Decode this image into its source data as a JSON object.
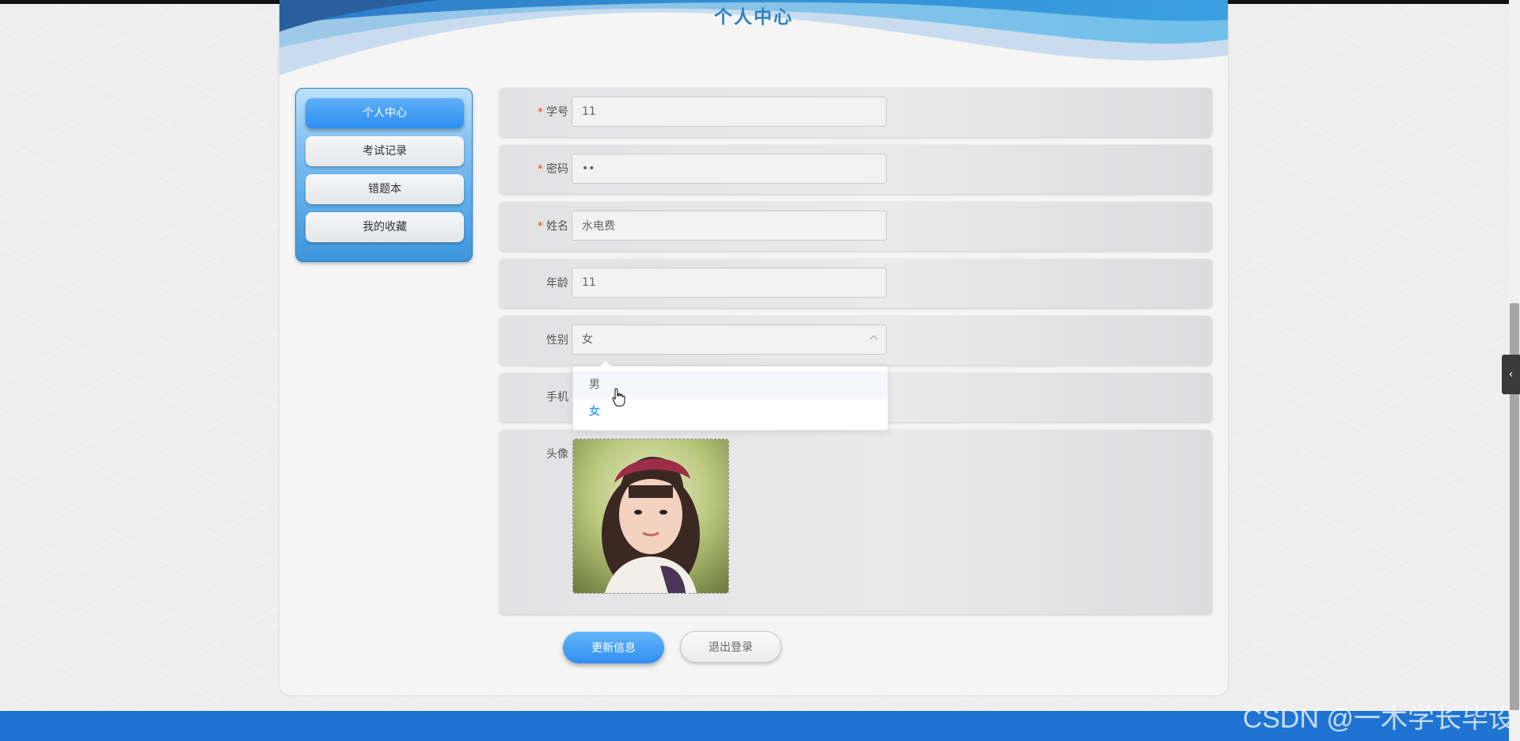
{
  "header": {
    "title": "个人中心"
  },
  "sidebar": {
    "items": [
      {
        "label": "个人中心",
        "active": true
      },
      {
        "label": "考试记录"
      },
      {
        "label": "错题本"
      },
      {
        "label": "我的收藏"
      }
    ]
  },
  "form": {
    "student_id": {
      "label": "学号",
      "required": true,
      "value": "11"
    },
    "password": {
      "label": "密码",
      "required": true,
      "value": "••"
    },
    "name": {
      "label": "姓名",
      "required": true,
      "value": "水电费"
    },
    "age": {
      "label": "年龄",
      "required": false,
      "value": "11"
    },
    "gender": {
      "label": "性别",
      "value": "女",
      "options": [
        "男",
        "女"
      ],
      "open": true,
      "selected": "女",
      "hovered": "男"
    },
    "phone": {
      "label": "手机"
    },
    "avatar": {
      "label": "头像"
    },
    "required_mark": "*"
  },
  "actions": {
    "update_label": "更新信息",
    "logout_label": "退出登录"
  },
  "watermark": "CSDN @一木学长毕设",
  "colors": {
    "accent": "#409eff",
    "footer": "#1f74d1",
    "title": "#2d83c0",
    "required": "#e0443a"
  },
  "icons": {
    "select": "chevron-up-icon",
    "panel_toggle": "chevron-left-icon",
    "pointer": "hand-pointer-icon"
  }
}
